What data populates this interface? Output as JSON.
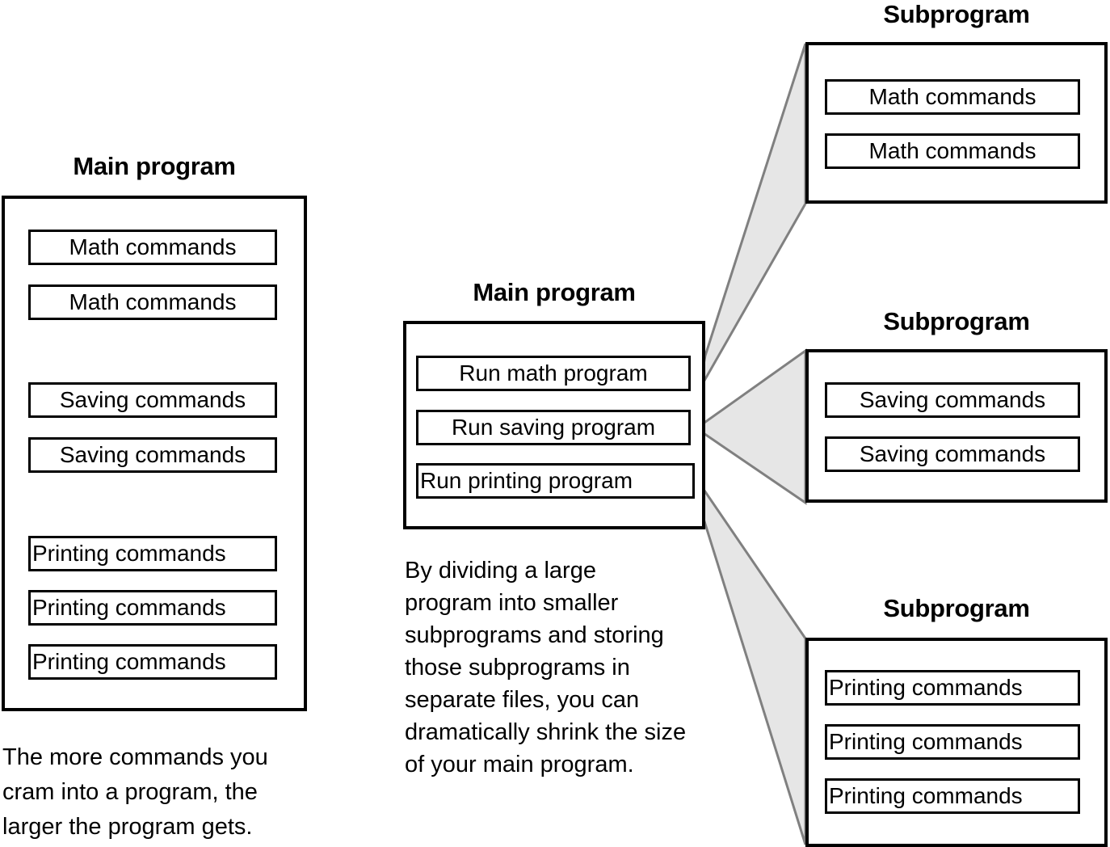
{
  "diagram": {
    "title_left": "Main program",
    "title_center": "Main program",
    "subprogram_title": "Subprogram",
    "accent_fill": "#e6e6e6",
    "accent_stroke": "#808080",
    "line_color": "#000000",
    "background": "#ffffff"
  },
  "left_panel": {
    "title": "Main program",
    "commands": [
      "Math commands",
      "Math commands",
      "Saving commands",
      "Saving commands",
      "Printing commands",
      "Printing commands",
      "Printing commands"
    ],
    "caption_lines": [
      "The more commands you",
      "cram into a program, the",
      "larger the program gets."
    ]
  },
  "center_panel": {
    "title": "Main program",
    "commands": [
      "Run math program",
      "Run saving program",
      "Run printing program"
    ],
    "caption_lines": [
      "By dividing a large",
      "program into smaller",
      "subprograms and storing",
      "those subprograms in",
      "separate files, you can",
      "dramatically shrink the size",
      "of your main program."
    ]
  },
  "subprograms": [
    {
      "title": "Subprogram",
      "commands": [
        "Math commands",
        "Math commands"
      ]
    },
    {
      "title": "Subprogram",
      "commands": [
        "Saving commands",
        "Saving commands"
      ]
    },
    {
      "title": "Subprogram",
      "commands": [
        "Printing commands",
        "Printing commands",
        "Printing commands"
      ]
    }
  ]
}
